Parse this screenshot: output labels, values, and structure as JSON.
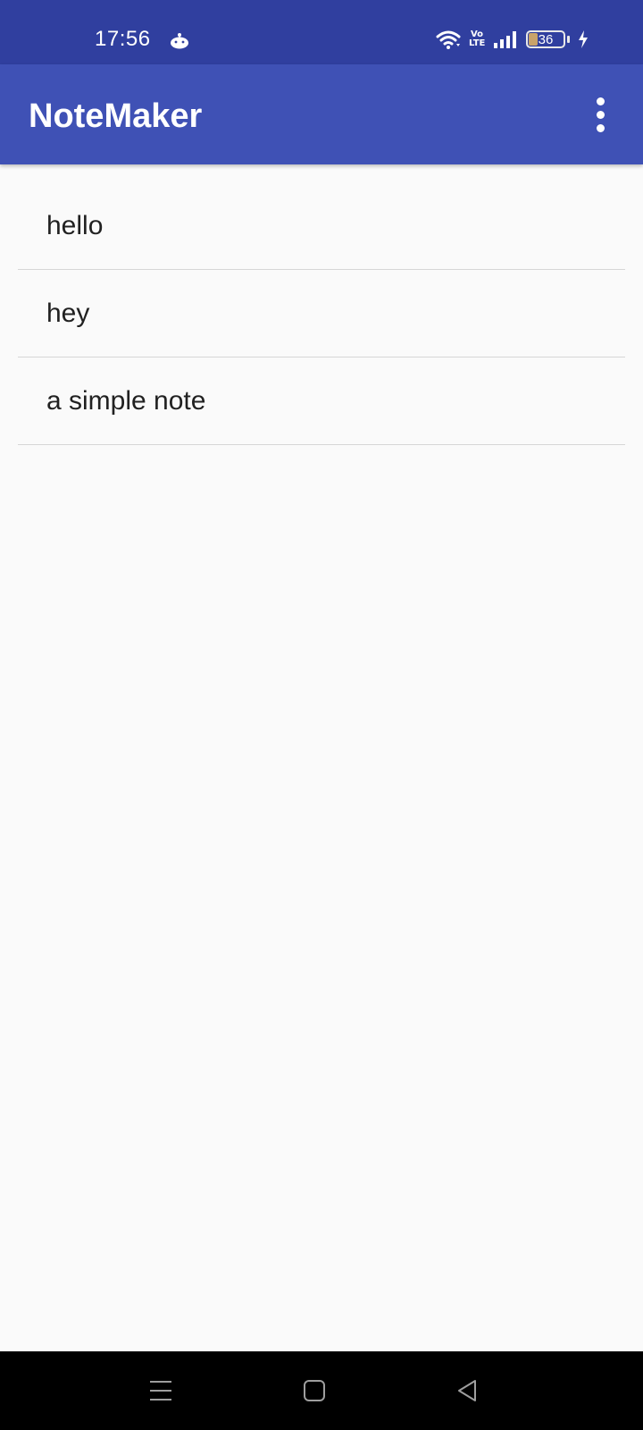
{
  "status_bar": {
    "time": "17:56",
    "volte_top": "Vo",
    "volte_bottom": "LTE",
    "battery_level": "36",
    "icons": [
      "reddit-icon",
      "wifi-icon",
      "volte-icon",
      "signal-icon",
      "battery-icon",
      "charging-icon"
    ]
  },
  "app_bar": {
    "title": "NoteMaker",
    "menu_icon": "more-vert-icon"
  },
  "notes": [
    {
      "title": "hello"
    },
    {
      "title": "hey"
    },
    {
      "title": "a simple note"
    }
  ],
  "nav_bar": {
    "icons": [
      "recents-icon",
      "home-icon",
      "back-icon"
    ]
  },
  "colors": {
    "status_bar": "#303f9f",
    "app_bar": "#3f51b5",
    "background": "#fafafa",
    "divider": "#d6d6d6"
  }
}
